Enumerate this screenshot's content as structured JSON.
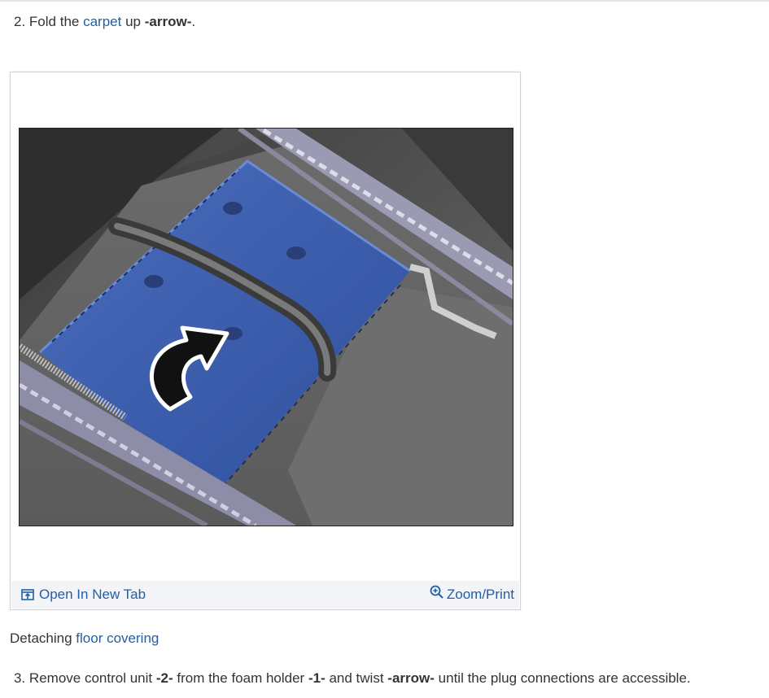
{
  "step2": {
    "number": "2.",
    "text_before": "Fold the",
    "link": "carpet",
    "text_middle": "up",
    "bold": "-arrow-",
    "text_after": "."
  },
  "figure": {
    "open_new_tab_label": "Open In New Tab",
    "zoom_print_label": "Zoom/Print",
    "open_tab_icon": "open-in-new-tab-icon",
    "zoom_icon": "zoom-in-icon"
  },
  "caption": {
    "text_before": "Detaching",
    "link": "floor covering"
  },
  "step3": {
    "number": "3.",
    "text_1": "Remove control unit",
    "bold_1": "-2-",
    "text_2": "from the foam holder",
    "bold_2": "-1-",
    "text_3": "and twist",
    "bold_3": "-arrow-",
    "text_4": "until the plug connections are accessible."
  },
  "colors": {
    "link": "#1f5fa8",
    "carpet_blue": "#3c5fae",
    "toolbar_bg": "#f2f4f7",
    "text": "#333333"
  }
}
